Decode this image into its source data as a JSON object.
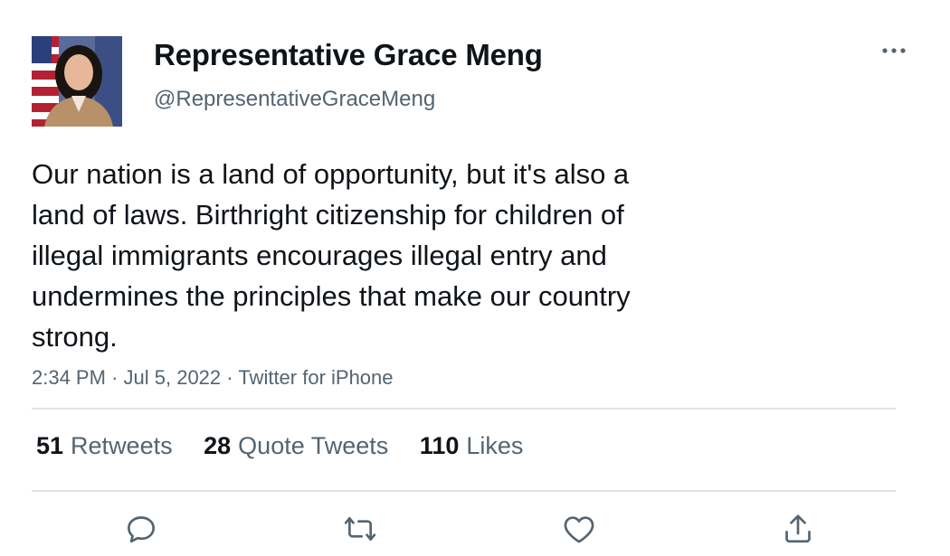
{
  "author": {
    "display_name": "Representative Grace Meng",
    "handle": "@RepresentativeGraceMeng",
    "avatar_icon": "profile-photo"
  },
  "tweet": {
    "text": "Our nation is a land of opportunity, but it's also a\nland of laws. Birthright citizenship for children of\nillegal immigrants encourages illegal entry and\nundermines the principles that make our country\nstrong.",
    "time": "2:34 PM",
    "date": "Jul 5, 2022",
    "source": "Twitter for iPhone",
    "separator": "·"
  },
  "stats": {
    "retweets": {
      "count": "51",
      "label": "Retweets"
    },
    "quotes": {
      "count": "28",
      "label": "Quote Tweets"
    },
    "likes": {
      "count": "110",
      "label": "Likes"
    }
  },
  "actions": {
    "more_icon": "more-horizontal-icon",
    "reply_icon": "reply-icon",
    "retweet_icon": "retweet-icon",
    "like_icon": "heart-icon",
    "share_icon": "share-icon"
  },
  "colors": {
    "text_primary": "#0f1419",
    "text_secondary": "#536471",
    "divider": "#dfe3e6"
  }
}
